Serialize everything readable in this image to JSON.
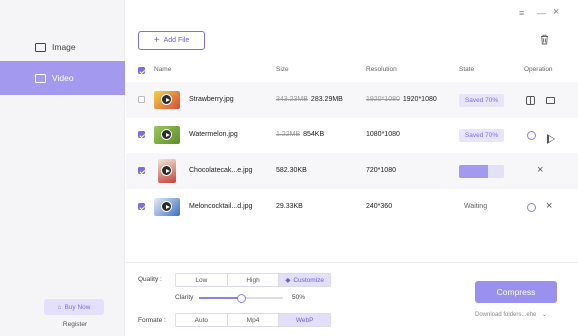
{
  "sidebar": {
    "items": [
      {
        "label": "Image",
        "icon": "image-icon",
        "active": false
      },
      {
        "label": "Video",
        "icon": "video-icon",
        "active": true
      }
    ],
    "buy_now": "Buy Now",
    "register": "Register"
  },
  "window": {
    "menu_icon": "≡",
    "minimize_icon": "—",
    "close_icon": "×"
  },
  "toolbar": {
    "add_file": "Add File"
  },
  "table": {
    "headers": {
      "name": "Name",
      "size": "Size",
      "resolution": "Resolution",
      "state": "State",
      "operation": "Operation"
    },
    "rows": [
      {
        "checked": false,
        "name": "Strawberry.jpg",
        "size_old": "343.23MB",
        "size_new": "283.29MB",
        "res_old": "1920*1080",
        "res_new": "1920*1080",
        "state": "Saved 70%"
      },
      {
        "checked": true,
        "name": "Watermelon.jpg",
        "size_old": "1.22MB",
        "size_new": "854KB",
        "res_old": "",
        "res_new": "1080*1080",
        "state": "Saved 70%"
      },
      {
        "checked": true,
        "name": "Chocolatecak...e.jpg",
        "size_old": "",
        "size_new": "582.30KB",
        "res_old": "",
        "res_new": "720*1080",
        "state": "",
        "progress": 0.65
      },
      {
        "checked": true,
        "name": "Meloncocktail...d.jpg",
        "size_old": "",
        "size_new": "29.33KB",
        "res_old": "",
        "res_new": "240*360",
        "state": "Waiting"
      }
    ]
  },
  "settings": {
    "quality_label": "Quality :",
    "quality_options": [
      "Low",
      "High",
      "Customize"
    ],
    "quality_selected": "Customize",
    "clarity_label": "Clarity",
    "clarity_value": "50%",
    "clarity_fraction": 0.5,
    "format_label": "Formate :",
    "format_options": [
      "Auto",
      "Mp4",
      "WebP"
    ],
    "format_selected": "WebP"
  },
  "actions": {
    "compress": "Compress",
    "download_folder": "Download folders...ehe"
  },
  "colors": {
    "accent": "#7b6fe0",
    "sidebar_active": "#a39af0"
  }
}
